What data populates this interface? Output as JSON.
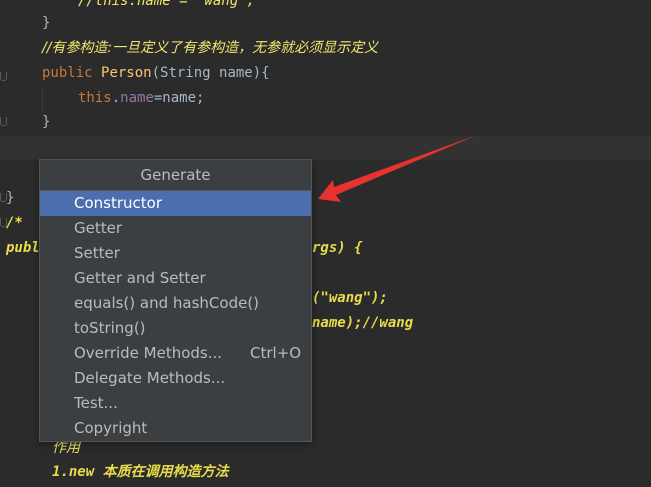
{
  "editor": {
    "lines": {
      "l0": "//this.name = \"wang\";",
      "l1_brace": "}",
      "l2_comment": "//有参构造:一旦定义了有参构造，无参就必须显示定义",
      "l3_public": "public",
      "l3_name": "Person",
      "l3_rest": "(String name){",
      "l4_this": "this",
      "l4_dot": ".",
      "l4_field": "name",
      "l4_rest": "=name;",
      "l5_brace": "}",
      "l6_brace": "}",
      "l7_doc": "/*",
      "l8_left": "publ",
      "l8_right": "rgs) {",
      "l9_right": "(\"wang\");",
      "l10_right": "name);//wang",
      "l11_text": "作用",
      "l12_text": "1.new 本质在调用构造方法"
    }
  },
  "generate_popup": {
    "title": "Generate",
    "items": [
      {
        "label": "Constructor",
        "selected": true
      },
      {
        "label": "Getter"
      },
      {
        "label": "Setter"
      },
      {
        "label": "Getter and Setter"
      },
      {
        "label": "equals() and hashCode()"
      },
      {
        "label": "toString()"
      },
      {
        "label": "Override Methods...",
        "shortcut": "Ctrl+O"
      },
      {
        "label": "Delegate Methods..."
      },
      {
        "label": "Test..."
      },
      {
        "label": "Copyright"
      }
    ]
  },
  "colors": {
    "background": "#2b2b2b",
    "keyword": "#cc7832",
    "method": "#ffc66d",
    "field": "#9876aa",
    "comment": "#f0e86c",
    "popup_bg": "#3c3f41",
    "selection": "#4b6eaf",
    "arrow": "#e8322f"
  },
  "annotation": {
    "icon": "red-arrow-icon"
  }
}
